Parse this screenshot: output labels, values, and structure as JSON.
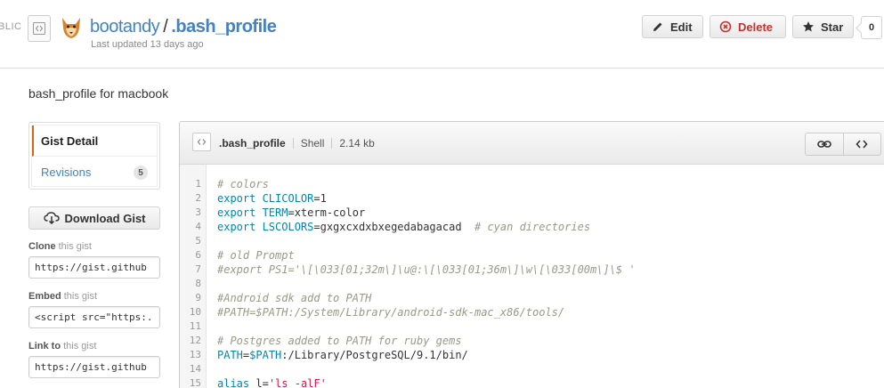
{
  "header": {
    "visibility_label": "BLIC",
    "owner": "bootandy",
    "separator": "/",
    "gist_name": ".bash_profile",
    "updated": "Last updated 13 days ago",
    "buttons": {
      "edit": "Edit",
      "delete": "Delete",
      "star": "Star"
    },
    "star_count": "0"
  },
  "description": "bash_profile for macbook",
  "sidebar": {
    "nav": [
      {
        "label": "Gist Detail",
        "selected": true
      },
      {
        "label": "Revisions",
        "count": "5"
      }
    ],
    "download_label": "Download Gist",
    "clone": {
      "label_bold": "Clone",
      "label_rest": " this gist",
      "value": "https://gist.github"
    },
    "embed": {
      "label_bold": "Embed",
      "label_rest": " this gist",
      "value": "<script src=\"https:..."
    },
    "link": {
      "label_bold": "Link to",
      "label_rest": " this gist",
      "value": "https://gist.github"
    }
  },
  "file": {
    "name": ".bash_profile",
    "language": "Shell",
    "size": "2.14 kb",
    "lines": [
      {
        "n": "1",
        "parts": [
          {
            "t": "# colors",
            "k": "comment"
          }
        ]
      },
      {
        "n": "2",
        "parts": [
          {
            "t": "export ",
            "k": "kw"
          },
          {
            "t": "CLICOLOR",
            "k": "kw"
          },
          {
            "t": "=1",
            "k": "plain"
          }
        ]
      },
      {
        "n": "3",
        "parts": [
          {
            "t": "export ",
            "k": "kw"
          },
          {
            "t": "TERM",
            "k": "kw"
          },
          {
            "t": "=xterm-color",
            "k": "plain"
          }
        ]
      },
      {
        "n": "4",
        "parts": [
          {
            "t": "export ",
            "k": "kw"
          },
          {
            "t": "LSCOLORS",
            "k": "kw"
          },
          {
            "t": "=gxgxcxdxbxegedabagacad  ",
            "k": "plain"
          },
          {
            "t": "# cyan directories",
            "k": "comment"
          }
        ]
      },
      {
        "n": "5",
        "parts": []
      },
      {
        "n": "6",
        "parts": [
          {
            "t": "# old Prompt",
            "k": "comment"
          }
        ]
      },
      {
        "n": "7",
        "parts": [
          {
            "t": "#export PS1='\\[\\033[01;32m\\]\\u@:\\[\\033[01;36m\\]\\w\\[\\033[00m\\]\\$ '",
            "k": "comment"
          }
        ]
      },
      {
        "n": "8",
        "parts": []
      },
      {
        "n": "9",
        "parts": [
          {
            "t": "#Android sdk add to PATH",
            "k": "comment"
          }
        ]
      },
      {
        "n": "10",
        "parts": [
          {
            "t": "#PATH=$PATH:/System/Library/android-sdk-mac_x86/tools/",
            "k": "comment"
          }
        ]
      },
      {
        "n": "11",
        "parts": []
      },
      {
        "n": "12",
        "parts": [
          {
            "t": "# Postgres added to PATH for ruby gems",
            "k": "comment"
          }
        ]
      },
      {
        "n": "13",
        "parts": [
          {
            "t": "PATH",
            "k": "kw"
          },
          {
            "t": "=",
            "k": "plain"
          },
          {
            "t": "$PATH",
            "k": "kw"
          },
          {
            "t": ":/Library/PostgreSQL/9.1/bin/",
            "k": "plain"
          }
        ]
      },
      {
        "n": "14",
        "parts": []
      },
      {
        "n": "15",
        "parts": [
          {
            "t": "alias ",
            "k": "kw"
          },
          {
            "t": "l",
            "k": "plain"
          },
          {
            "t": "=",
            "k": "plain"
          },
          {
            "t": "'ls -alF'",
            "k": "str"
          }
        ]
      }
    ]
  },
  "colors": {
    "link": "#4183c4",
    "danger": "#c9302c",
    "accent": "#d26911"
  },
  "icons": [
    "gist-code-icon",
    "avatar-icon",
    "pencil-icon",
    "x-circle-icon",
    "star-icon",
    "cloud-download-icon",
    "file-code-icon",
    "link-icon",
    "embed-code-icon"
  ]
}
